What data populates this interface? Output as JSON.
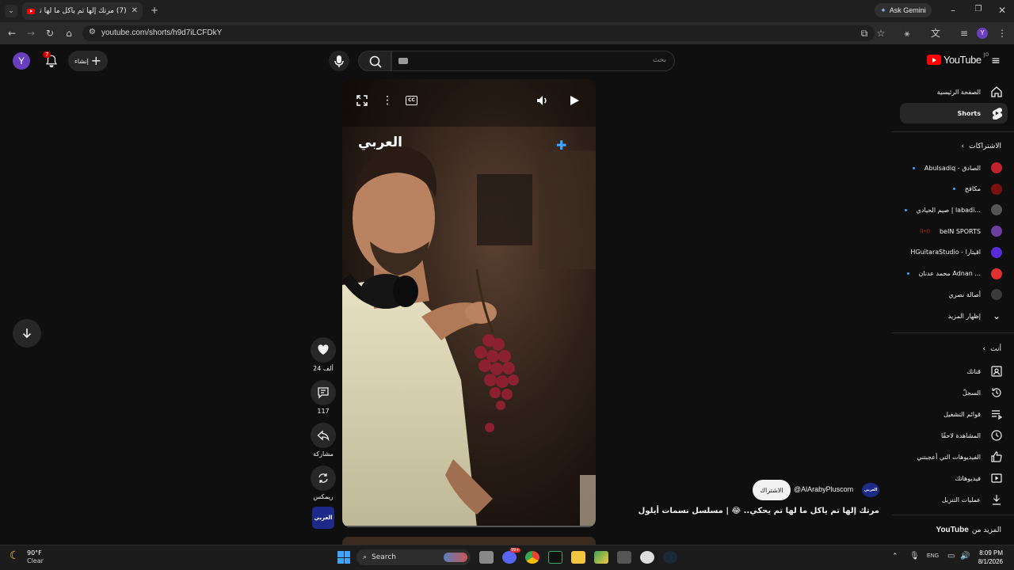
{
  "browser": {
    "tab_title": "(7) مرتك إلها تم ياكل ما لها تم بحث",
    "url": "youtube.com/shorts/h9d7iLCFDkY",
    "ask_gemini": "Ask Gemini",
    "profile_initial": "Y"
  },
  "yt_header": {
    "avatar_initial": "Y",
    "notification_count": "7",
    "create_label": "إنشاء",
    "search_placeholder": "بحث",
    "logo_text": "YouTube",
    "logo_region": "JO"
  },
  "sidebar": {
    "home": "الصفحة الرئيسية",
    "shorts": "Shorts",
    "subscriptions_header": "الاشتراكات",
    "channels": [
      {
        "name": "Abulsadiq - الصادق",
        "color": "#c0222e",
        "dot": true
      },
      {
        "name": "مكافح",
        "color": "#7a1212",
        "dot": true
      },
      {
        "name": "صيم الحيادي | labadi...",
        "color": "#555555",
        "dot": true
      },
      {
        "name": "beIN SPORTS",
        "color": "#6b3fa0",
        "dot": false,
        "live": true
      },
      {
        "name": "HGuitaraStudio - اقيتارا",
        "color": "#5a2bd8",
        "dot": false
      },
      {
        "name": "محمد عدنان Adnan ...",
        "color": "#e03030",
        "dot": true
      },
      {
        "name": "أصالة نصري",
        "color": "#3a3a3a",
        "dot": false
      }
    ],
    "show_more": "إظهار المزيد",
    "you_header": "أنت",
    "you_items": [
      "قناتك",
      "السجلّ",
      "قوائم التشغيل",
      "المشاهدة لاحقًا",
      "الفيديوهات التي أعجبتني",
      "فيديوهاتك",
      "عمليات التنزيل"
    ],
    "more_from": "المزيد من",
    "more_from_brand": "YouTube"
  },
  "short": {
    "watermark": "العربي",
    "channel_handle": "@AlArabyPluscom",
    "subscribe_label": "الاشتراك",
    "title": "مرتك إلها تم ياكل ما لها تم يحكي.. 😂 | مسلسل نسمات أيلول",
    "channel_badge": "العربي"
  },
  "actions": {
    "likes": "24 ألف",
    "comments": "117",
    "share": "مشاركة",
    "remix": "ريمكس"
  },
  "taskbar": {
    "weather_temp": "90°F",
    "weather_desc": "Clear",
    "search_label": "Search",
    "lang": "ENG",
    "time": "8:09 PM",
    "date": "8/1/2026",
    "discord_badge": "99+"
  },
  "colors": {
    "youtube_red": "#ff0000",
    "accent_blue": "#3ea6ff",
    "background": "#0f0f0f"
  }
}
